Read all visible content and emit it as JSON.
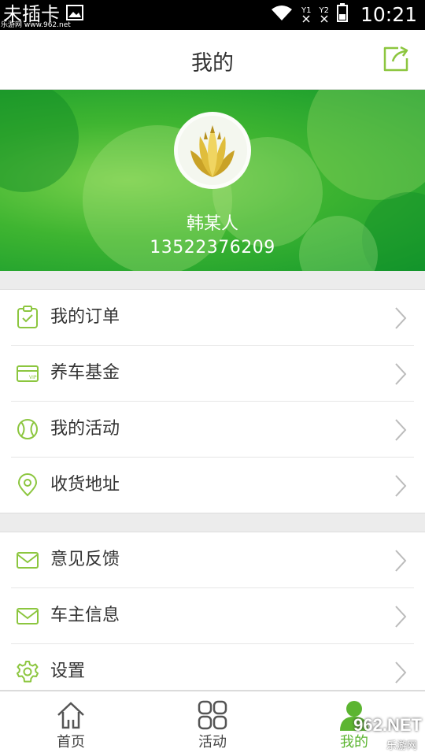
{
  "status_bar": {
    "carrier": "未插卡",
    "watermark": "乐游网 www.962.net",
    "sim1": "Y1",
    "sim2": "Y2",
    "time": "10:21"
  },
  "header": {
    "title": "我的"
  },
  "profile": {
    "name": "韩某人",
    "phone": "13522376209"
  },
  "menu": {
    "group1": [
      {
        "label": "我的订单",
        "icon": "clipboard-check-icon"
      },
      {
        "label": "养车基金",
        "icon": "vip-card-icon"
      },
      {
        "label": "我的活动",
        "icon": "ball-icon"
      },
      {
        "label": "收货地址",
        "icon": "location-pin-icon"
      }
    ],
    "group2": [
      {
        "label": "意见反馈",
        "icon": "mail-icon"
      },
      {
        "label": "车主信息",
        "icon": "mail-icon"
      },
      {
        "label": "设置",
        "icon": "gear-icon"
      }
    ]
  },
  "tabs": [
    {
      "label": "首页",
      "icon": "home-icon",
      "active": false
    },
    {
      "label": "活动",
      "icon": "grid-icon",
      "active": false
    },
    {
      "label": "我的",
      "icon": "user-icon",
      "active": true
    }
  ],
  "watermark": {
    "logo": "962.NET",
    "sub": "乐游网"
  },
  "colors": {
    "accent": "#8cc63f",
    "banner": "#3fb531",
    "active_tab": "#5cb531"
  }
}
